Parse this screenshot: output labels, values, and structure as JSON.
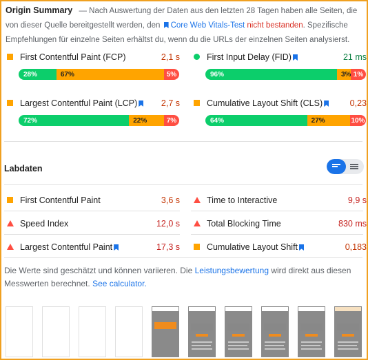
{
  "intro": {
    "title": "Origin Summary",
    "text1": " — Nach Auswertung der Daten aus den letzten 28 Tagen haben alle Seiten, die von dieser Quelle bereitgestellt werden, den ",
    "link": "Core Web Vitals-Test",
    "fail": "nicht bestanden",
    "text2": ". Spezifische Empfehlungen für einzelne Seiten erhältst du, wenn du die URLs der einzelnen Seiten analysierst."
  },
  "field_metrics": [
    {
      "label": "First Contentful Paint (FCP)",
      "value": "2,1 s",
      "status": "average",
      "bookmark": false,
      "distribution": {
        "good": "28%",
        "average": "67%",
        "poor": "5%"
      },
      "dist_values": [
        28,
        67,
        5
      ]
    },
    {
      "label": "First Input Delay (FID)",
      "value": "21 ms",
      "status": "good",
      "bookmark": true,
      "distribution": {
        "good": "96%",
        "average": "3%",
        "poor": "1%"
      },
      "dist_values": [
        96,
        3,
        1
      ]
    },
    {
      "label": "Largest Contentful Paint (LCP)",
      "value": "2,7 s",
      "status": "average",
      "bookmark": true,
      "distribution": {
        "good": "72%",
        "average": "22%",
        "poor": "7%"
      },
      "dist_values": [
        72,
        22,
        7
      ]
    },
    {
      "label": "Cumulative Layout Shift (CLS)",
      "value": "0,23",
      "status": "average",
      "bookmark": true,
      "distribution": {
        "good": "64%",
        "average": "27%",
        "poor": "10%"
      },
      "dist_values": [
        64,
        27,
        10
      ]
    }
  ],
  "lab": {
    "title": "Labdaten",
    "metrics": [
      {
        "label": "First Contentful Paint",
        "value": "3,6 s",
        "status": "average"
      },
      {
        "label": "Time to Interactive",
        "value": "9,9 s",
        "status": "poor"
      },
      {
        "label": "Speed Index",
        "value": "12,0 s",
        "status": "poor"
      },
      {
        "label": "Total Blocking Time",
        "value": "830 ms",
        "status": "poor"
      },
      {
        "label": "Largest Contentful Paint",
        "value": "17,3 s",
        "status": "poor"
      },
      {
        "label": "Cumulative Layout Shift",
        "value": "0,183",
        "status": "average"
      }
    ]
  },
  "note": {
    "text1": "Die Werte sind geschätzt und können variieren. Die ",
    "link1": "Leistungsbewertung",
    "text2": " wird direkt aus diesen Messwerten berechnet. ",
    "link2": "See calculator."
  },
  "colors": {
    "good": "#0cce6b",
    "average": "#ffa400",
    "poor": "#ff4e42",
    "link": "#1a73e8"
  }
}
